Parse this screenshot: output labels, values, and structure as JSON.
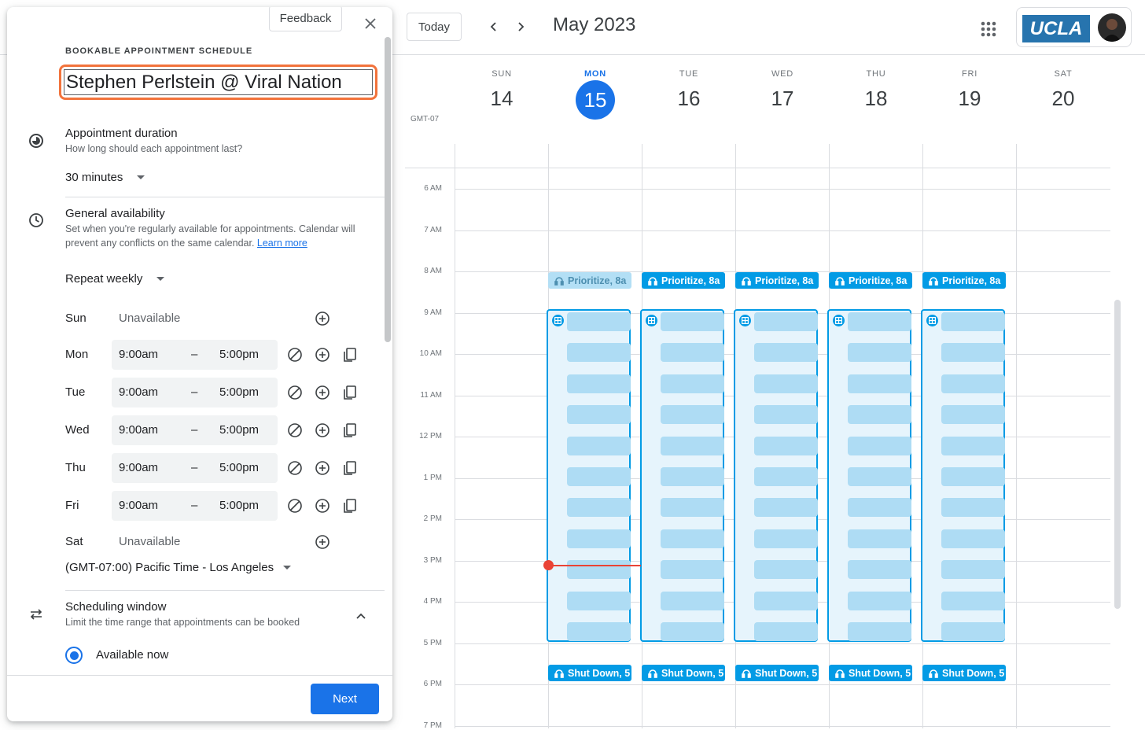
{
  "calendar": {
    "today_label": "Today",
    "month_label": "May 2023",
    "timezone_label": "GMT-07",
    "account_logo": "UCLA",
    "days": [
      {
        "name": "SUN",
        "num": "14"
      },
      {
        "name": "MON",
        "num": "15",
        "today": true
      },
      {
        "name": "TUE",
        "num": "16"
      },
      {
        "name": "WED",
        "num": "17"
      },
      {
        "name": "THU",
        "num": "18"
      },
      {
        "name": "FRI",
        "num": "19"
      },
      {
        "name": "SAT",
        "num": "20"
      }
    ],
    "hours": [
      "6 AM",
      "7 AM",
      "8 AM",
      "9 AM",
      "10 AM",
      "11 AM",
      "12 PM",
      "1 PM",
      "2 PM",
      "3 PM",
      "4 PM",
      "5 PM",
      "6 PM",
      "7 PM"
    ],
    "focus_morning_label": "Prioritize, 8a",
    "focus_evening_label": "Shut Down, 5",
    "slot_count": 11,
    "colors": {
      "event": "#039be5",
      "slot": "#aedcf4",
      "now": "#ea4335",
      "today": "#1a73e8"
    }
  },
  "panel": {
    "feedback_label": "Feedback",
    "kicker": "BOOKABLE APPOINTMENT SCHEDULE",
    "title_value": "Stephen Perlstein @ Viral Nation",
    "duration": {
      "title": "Appointment duration",
      "subtitle": "How long should each appointment last?",
      "value": "30 minutes"
    },
    "availability": {
      "title": "General availability",
      "subtitle": "Set when you're regularly available for appointments. Calendar will prevent any conflicts on the same calendar.",
      "learn_more": "Learn more",
      "repeat": "Repeat weekly",
      "dash": "–",
      "rows": [
        {
          "day": "Sun",
          "unavailable": "Unavailable"
        },
        {
          "day": "Mon",
          "start": "9:00am",
          "end": "5:00pm"
        },
        {
          "day": "Tue",
          "start": "9:00am",
          "end": "5:00pm"
        },
        {
          "day": "Wed",
          "start": "9:00am",
          "end": "5:00pm"
        },
        {
          "day": "Thu",
          "start": "9:00am",
          "end": "5:00pm"
        },
        {
          "day": "Fri",
          "start": "9:00am",
          "end": "5:00pm"
        },
        {
          "day": "Sat",
          "unavailable": "Unavailable"
        }
      ],
      "timezone": "(GMT-07:00) Pacific Time - Los Angeles"
    },
    "scheduling": {
      "title": "Scheduling window",
      "subtitle": "Limit the time range that appointments can be booked",
      "option": "Available now"
    },
    "next_label": "Next"
  }
}
